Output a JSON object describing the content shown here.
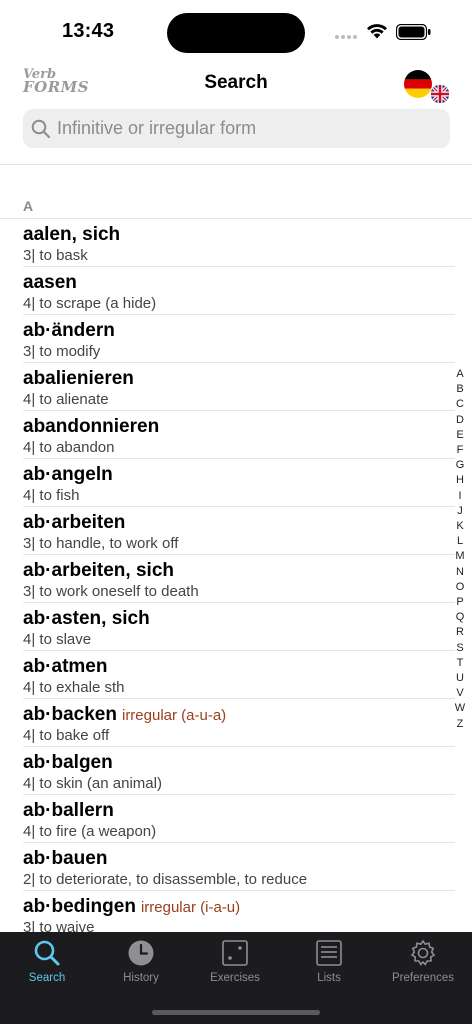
{
  "status": {
    "time": "13:43"
  },
  "nav": {
    "logo_line1": "Verb",
    "logo_line2": "FORMS",
    "title": "Search"
  },
  "search": {
    "placeholder": "Infinitive or irregular form",
    "value": ""
  },
  "list": {
    "section": "A",
    "rows": [
      {
        "headword": "aalen, sich",
        "irregular": "",
        "meaning": "3| to bask"
      },
      {
        "headword": "aasen",
        "irregular": "",
        "meaning": "4| to scrape (a hide)"
      },
      {
        "headword": "ab·ändern",
        "irregular": "",
        "meaning": "3| to modify"
      },
      {
        "headword": "abalienieren",
        "irregular": "",
        "meaning": "4| to alienate"
      },
      {
        "headword": "abandonnieren",
        "irregular": "",
        "meaning": "4| to abandon"
      },
      {
        "headword": "ab·angeln",
        "irregular": "",
        "meaning": "4| to fish"
      },
      {
        "headword": "ab·arbeiten",
        "irregular": "",
        "meaning": "3| to handle, to work off"
      },
      {
        "headword": "ab·arbeiten, sich",
        "irregular": "",
        "meaning": "3| to work oneself to death"
      },
      {
        "headword": "ab·asten, sich",
        "irregular": "",
        "meaning": "4| to slave"
      },
      {
        "headword": "ab·atmen",
        "irregular": "",
        "meaning": "4| to exhale sth"
      },
      {
        "headword": "ab·backen",
        "irregular": "irregular (a-u-a)",
        "meaning": "4| to bake off"
      },
      {
        "headword": "ab·balgen",
        "irregular": "",
        "meaning": "4| to skin (an animal)"
      },
      {
        "headword": "ab·ballern",
        "irregular": "",
        "meaning": "4| to fire (a weapon)"
      },
      {
        "headword": "ab·bauen",
        "irregular": "",
        "meaning": "2| to deteriorate, to disassemble, to reduce"
      },
      {
        "headword": "ab·bedingen",
        "irregular": "irregular (i-a-u)",
        "meaning": "3| to waive"
      }
    ]
  },
  "alphabet": [
    "A",
    "B",
    "C",
    "D",
    "E",
    "F",
    "G",
    "H",
    "I",
    "J",
    "K",
    "L",
    "M",
    "N",
    "O",
    "P",
    "Q",
    "R",
    "S",
    "T",
    "U",
    "V",
    "W",
    "Z"
  ],
  "tabs": [
    {
      "id": "search",
      "label": "Search",
      "icon": "magnifier-icon",
      "active": true
    },
    {
      "id": "history",
      "label": "History",
      "icon": "clock-icon",
      "active": false
    },
    {
      "id": "exercises",
      "label": "Exercises",
      "icon": "dice-icon",
      "active": false
    },
    {
      "id": "lists",
      "label": "Lists",
      "icon": "list-icon",
      "active": false
    },
    {
      "id": "preferences",
      "label": "Preferences",
      "icon": "gear-icon",
      "active": false
    }
  ],
  "colors": {
    "accent": "#5ec8f0",
    "irregular": "#9a3f1c",
    "tabbar": "#1c1c1e"
  }
}
